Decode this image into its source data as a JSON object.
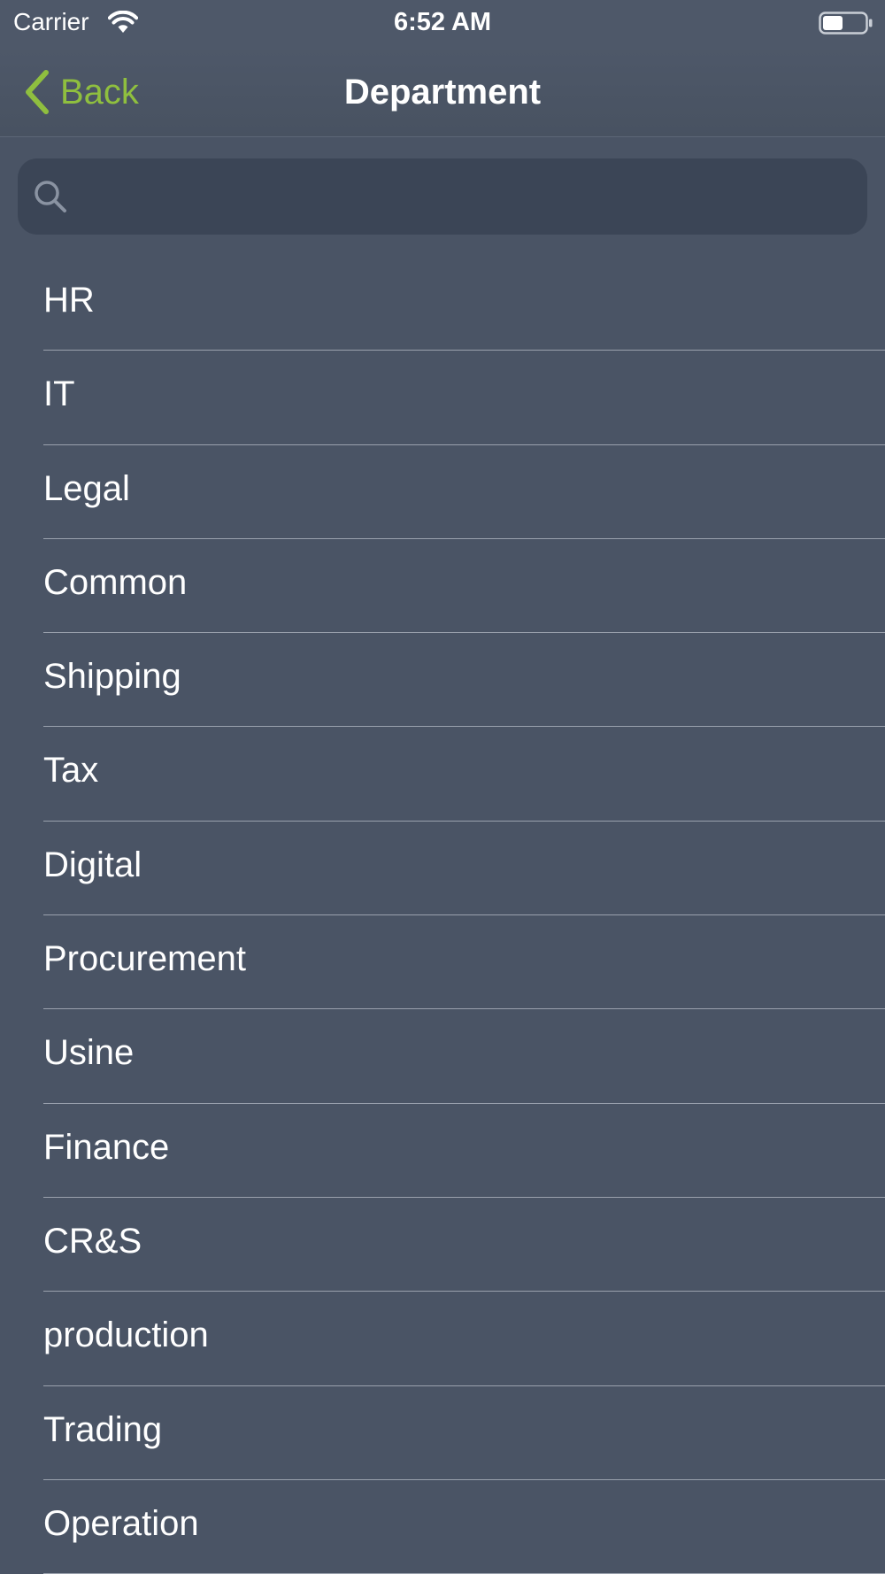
{
  "status_bar": {
    "carrier": "Carrier",
    "time": "6:52 AM",
    "icons": [
      "wifi-icon",
      "battery-icon"
    ]
  },
  "nav_bar": {
    "back_label": "Back",
    "title": "Department",
    "accent_color": "#8fbf3f"
  },
  "search": {
    "placeholder": "",
    "value": ""
  },
  "departments": [
    {
      "label": "HR"
    },
    {
      "label": "IT"
    },
    {
      "label": "Legal"
    },
    {
      "label": "Common"
    },
    {
      "label": "Shipping"
    },
    {
      "label": "Tax"
    },
    {
      "label": "Digital"
    },
    {
      "label": "Procurement"
    },
    {
      "label": "Usine"
    },
    {
      "label": "Finance"
    },
    {
      "label": "CR&S"
    },
    {
      "label": "production"
    },
    {
      "label": "Trading"
    },
    {
      "label": "Operation"
    }
  ]
}
